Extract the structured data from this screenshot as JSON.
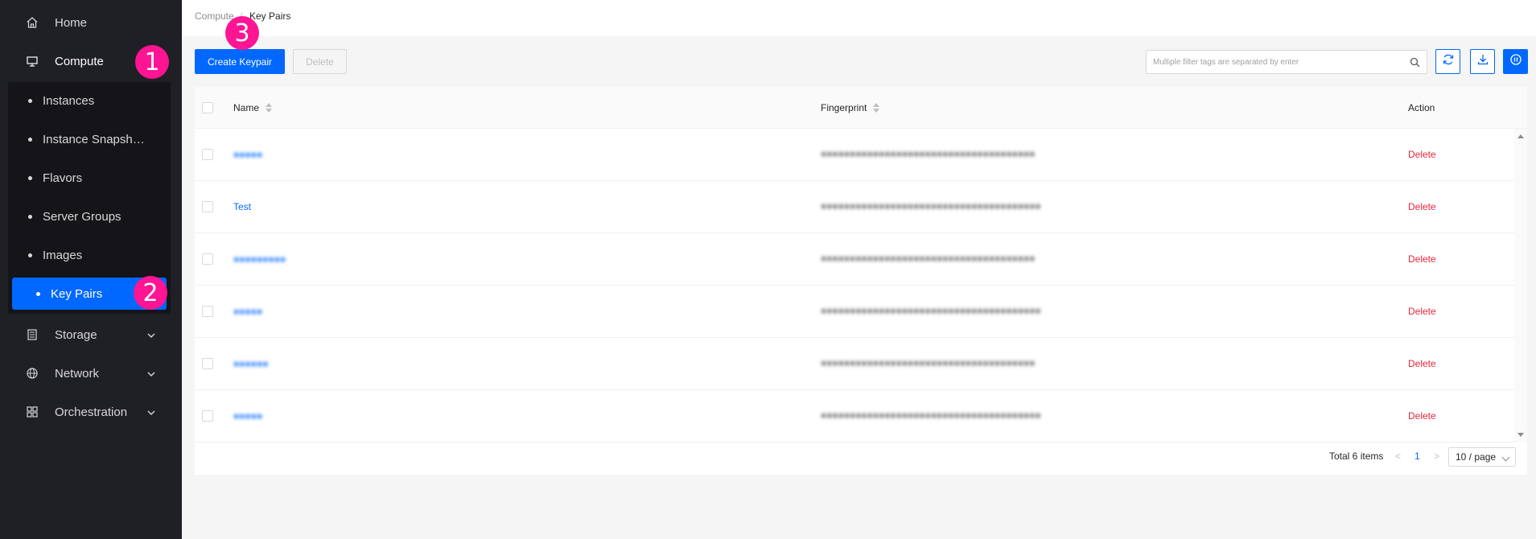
{
  "sidebar": {
    "items": [
      {
        "label": "Home",
        "icon": "home-icon"
      },
      {
        "label": "Compute",
        "icon": "monitor-icon"
      },
      {
        "label": "Storage",
        "icon": "storage-icon"
      },
      {
        "label": "Network",
        "icon": "globe-icon"
      },
      {
        "label": "Orchestration",
        "icon": "grid-icon"
      }
    ],
    "compute_children": [
      "Instances",
      "Instance Snapsh…",
      "Flavors",
      "Server Groups",
      "Images",
      "Key Pairs"
    ]
  },
  "badges": [
    "1",
    "2",
    "3"
  ],
  "breadcrumb": {
    "parent": "Compute",
    "separator": "/",
    "current": "Key Pairs"
  },
  "toolbar": {
    "create_label": "Create Keypair",
    "delete_label": "Delete",
    "search_placeholder": "Multiple filter tags are separated by enter"
  },
  "table": {
    "columns": {
      "name": "Name",
      "fingerprint": "Fingerprint",
      "action": "Action"
    },
    "rows": [
      {
        "name": "●●●●●",
        "fingerprint": "●●●●●●●●●●●●●●●●●●●●●●●●●●●●●●●●●●●●●",
        "action": "Delete"
      },
      {
        "name": "Test",
        "fingerprint": "●●●●●●●●●●●●●●●●●●●●●●●●●●●●●●●●●●●●●●",
        "action": "Delete"
      },
      {
        "name": "●●●●●●●●●",
        "fingerprint": "●●●●●●●●●●●●●●●●●●●●●●●●●●●●●●●●●●●●●",
        "action": "Delete"
      },
      {
        "name": "●●●●●",
        "fingerprint": "●●●●●●●●●●●●●●●●●●●●●●●●●●●●●●●●●●●●●●",
        "action": "Delete"
      },
      {
        "name": "●●●●●●",
        "fingerprint": "●●●●●●●●●●●●●●●●●●●●●●●●●●●●●●●●●●●●●",
        "action": "Delete"
      },
      {
        "name": "●●●●●",
        "fingerprint": "●●●●●●●●●●●●●●●●●●●●●●●●●●●●●●●●●●●●●●",
        "action": "Delete"
      }
    ]
  },
  "pagination": {
    "total": "Total 6 items",
    "prev": "<",
    "page": "1",
    "next": ">",
    "page_size": "10 / page"
  },
  "colors": {
    "accent": "#0068ff",
    "danger": "#e8253d",
    "badge": "#ff1493",
    "sidebar": "#1f1f26"
  }
}
